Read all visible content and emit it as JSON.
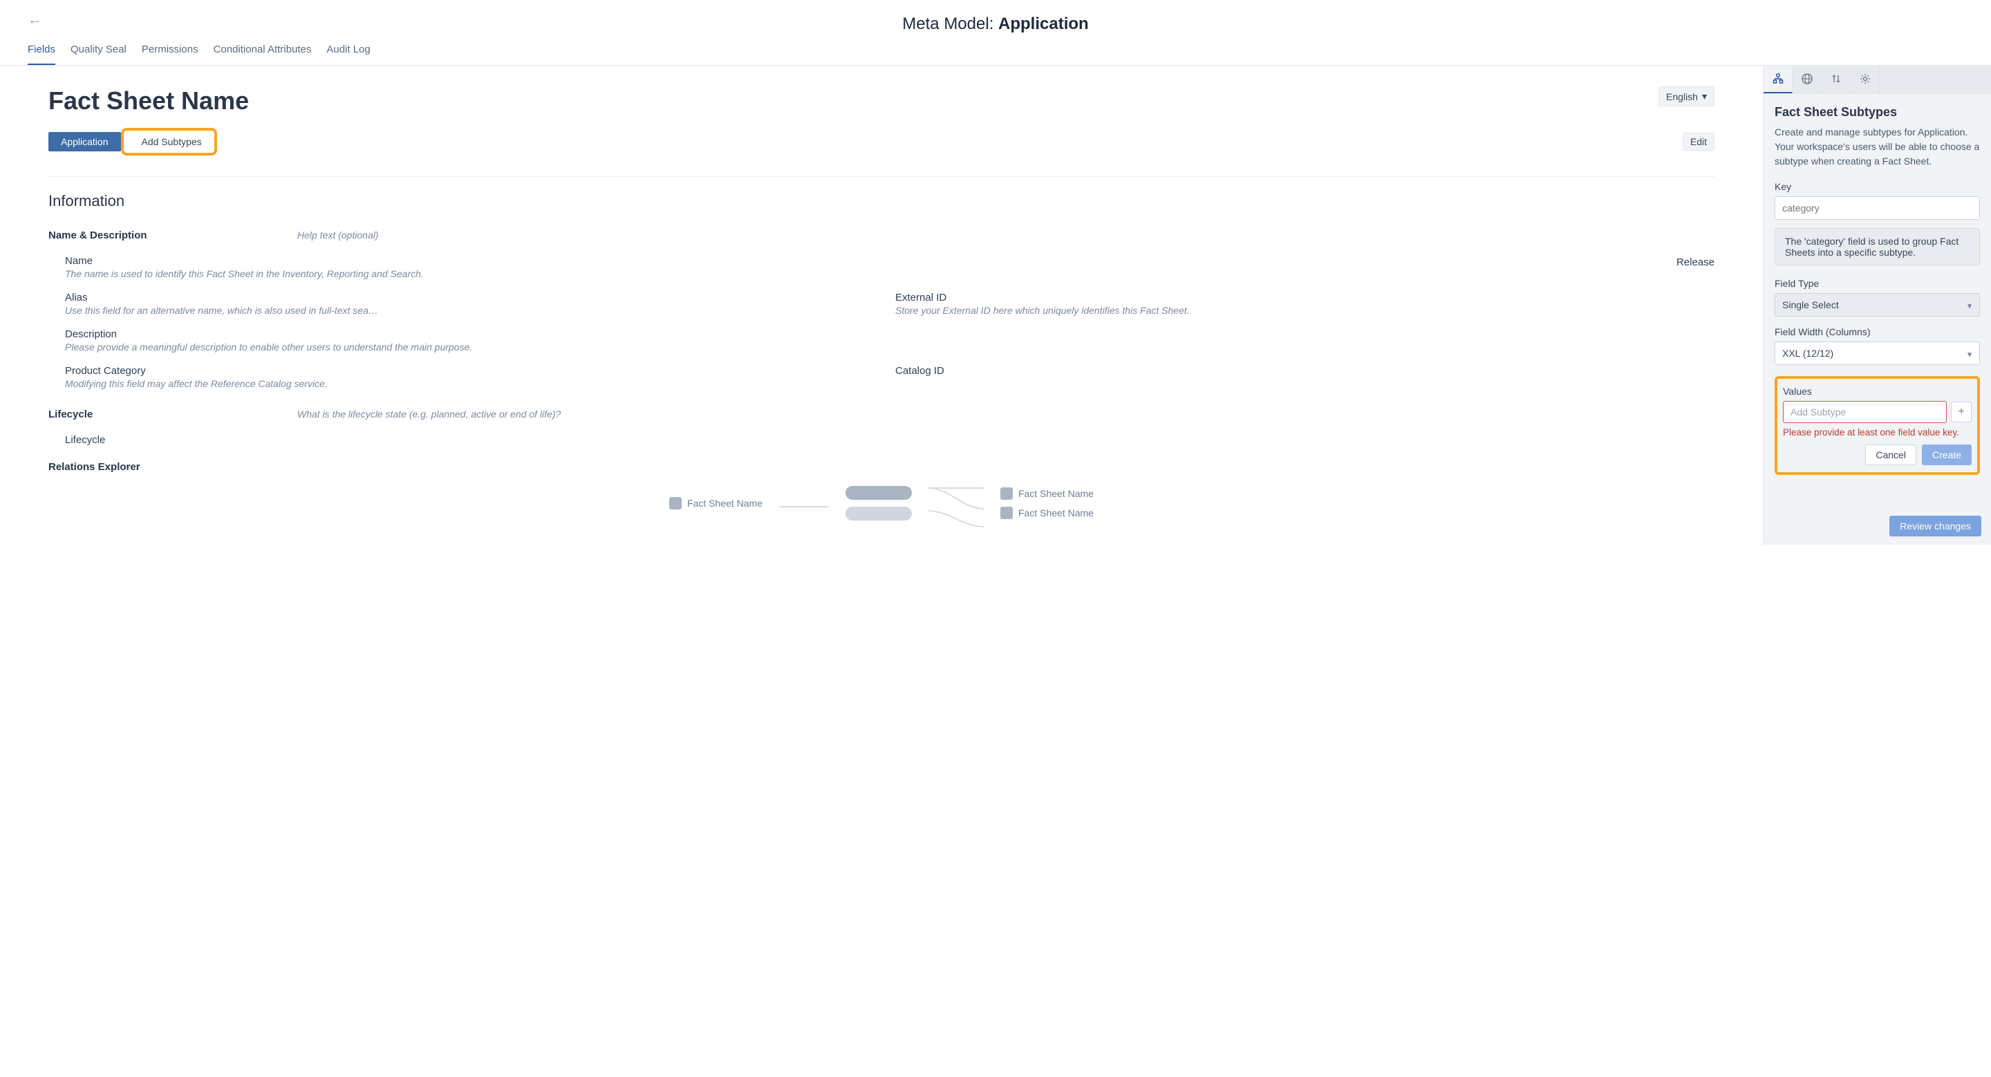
{
  "header": {
    "title_prefix": "Meta Model: ",
    "title_bold": "Application"
  },
  "tabs": [
    "Fields",
    "Quality Seal",
    "Permissions",
    "Conditional Attributes",
    "Audit Log"
  ],
  "active_tab": 0,
  "main": {
    "heading": "Fact Sheet Name",
    "language": "English",
    "subtype_pill": "Application",
    "add_subtypes_label": "Add Subtypes",
    "edit_label": "Edit",
    "section_title": "Information",
    "group_name_desc": {
      "label": "Name & Description",
      "help": "Help text (optional)",
      "release_label": "Release",
      "fields": {
        "name": {
          "label": "Name",
          "desc": "The name is used to identify this Fact Sheet in the Inventory, Reporting and Search."
        },
        "alias": {
          "label": "Alias",
          "desc": "Use this field for an alternative name, which is also used in full-text sea…"
        },
        "external_id": {
          "label": "External ID",
          "desc": "Store your External ID here which uniquely identifies this Fact Sheet."
        },
        "description": {
          "label": "Description",
          "desc": "Please provide a meaningful description to enable other users to understand the main purpose."
        },
        "product_category": {
          "label": "Product Category",
          "desc": "Modifying this field may affect the Reference Catalog service."
        },
        "catalog_id": {
          "label": "Catalog ID",
          "desc": ""
        }
      }
    },
    "lifecycle": {
      "label": "Lifecycle",
      "help": "What is the lifecycle state (e.g. planned, active or end of life)?",
      "field_label": "Lifecycle"
    },
    "relations": {
      "title": "Relations Explorer",
      "node_label": "Fact Sheet Name"
    }
  },
  "sidebar": {
    "title": "Fact Sheet Subtypes",
    "description": "Create and manage subtypes for Application. Your workspace's users will be able to choose a subtype when creating a Fact Sheet.",
    "key_label": "Key",
    "key_placeholder": "category",
    "info_text": "The 'category' field is used to group Fact Sheets into a specific subtype.",
    "field_type_label": "Field Type",
    "field_type_value": "Single Select",
    "field_width_label": "Field Width (Columns)",
    "field_width_value": "XXL (12/12)",
    "values_label": "Values",
    "values_placeholder": "Add Subtype",
    "error_text": "Please provide at least one field value key.",
    "cancel_label": "Cancel",
    "create_label": "Create",
    "review_label": "Review changes"
  }
}
